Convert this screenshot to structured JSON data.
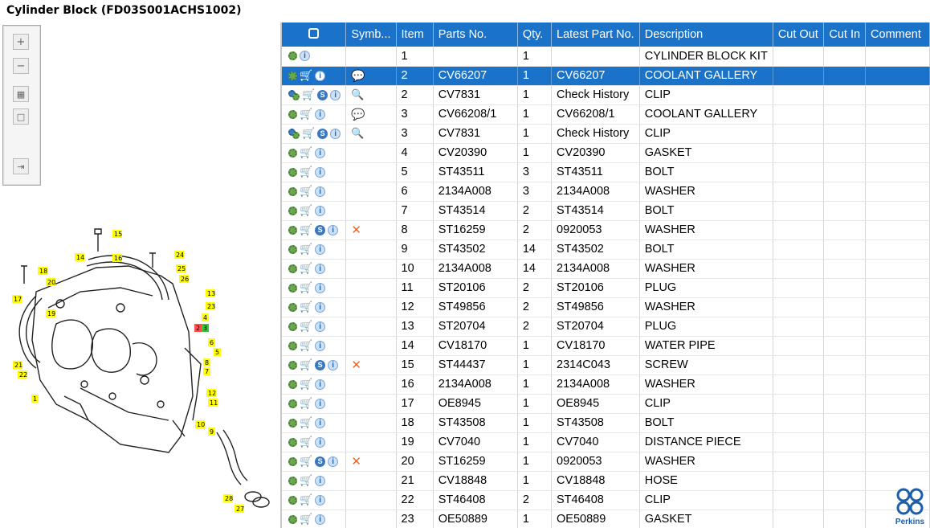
{
  "window": {
    "title": "Cylinder Block (FD03S001ACHS1002)"
  },
  "toolbar": {
    "buttons": [
      {
        "name": "zoom-in-button",
        "icon": "plus-icon"
      },
      {
        "name": "zoom-out-button",
        "icon": "minus-icon"
      },
      {
        "name": "fit-view-button",
        "icon": "grid-icon"
      },
      {
        "name": "actual-size-button",
        "icon": "square-icon"
      },
      {
        "name": "export-button",
        "icon": "export-icon"
      }
    ]
  },
  "diagram": {
    "callouts": [
      "1",
      "2",
      "3",
      "4",
      "5",
      "6",
      "7",
      "8",
      "9",
      "10",
      "11",
      "12",
      "13",
      "14",
      "15",
      "16",
      "17",
      "18",
      "19",
      "20",
      "21",
      "22",
      "23",
      "24",
      "25",
      "26",
      "27",
      "28"
    ]
  },
  "table": {
    "columns": [
      "",
      "Symb...",
      "Item",
      "Parts No.",
      "Qty.",
      "Latest Part No.",
      "Description",
      "Cut Out",
      "Cut In",
      "Comment"
    ],
    "rows": [
      {
        "icons": "gear,info",
        "sym": "",
        "item": "1",
        "part": "",
        "qty": "1",
        "latest": "",
        "desc": "CYLINDER BLOCK KIT",
        "selected": false
      },
      {
        "icons": "gear,cart,info",
        "sym": "bubble",
        "item": "2",
        "part": "CV66207",
        "qty": "1",
        "latest": "CV66207",
        "desc": "COOLANT GALLERY",
        "selected": true
      },
      {
        "icons": "gears,cart,s,info",
        "sym": "history",
        "item": "2",
        "part": "CV7831",
        "qty": "1",
        "latest": "Check History",
        "desc": "CLIP",
        "selected": false
      },
      {
        "icons": "gear,cart,info",
        "sym": "bubble",
        "item": "3",
        "part": "CV66208/1",
        "qty": "1",
        "latest": "CV66208/1",
        "desc": "COOLANT GALLERY",
        "selected": false
      },
      {
        "icons": "gears,cart,s,info",
        "sym": "history",
        "item": "3",
        "part": "CV7831",
        "qty": "1",
        "latest": "Check History",
        "desc": "CLIP",
        "selected": false
      },
      {
        "icons": "gear,cart,info",
        "sym": "",
        "item": "4",
        "part": "CV20390",
        "qty": "1",
        "latest": "CV20390",
        "desc": "GASKET",
        "selected": false
      },
      {
        "icons": "gear,cart,info",
        "sym": "",
        "item": "5",
        "part": "ST43511",
        "qty": "3",
        "latest": "ST43511",
        "desc": "BOLT",
        "selected": false
      },
      {
        "icons": "gear,cart,info",
        "sym": "",
        "item": "6",
        "part": "2134A008",
        "qty": "3",
        "latest": "2134A008",
        "desc": "WASHER",
        "selected": false
      },
      {
        "icons": "gear,cart,info",
        "sym": "",
        "item": "7",
        "part": "ST43514",
        "qty": "2",
        "latest": "ST43514",
        "desc": "BOLT",
        "selected": false
      },
      {
        "icons": "gear,cart,s,info",
        "sym": "x",
        "item": "8",
        "part": "ST16259",
        "qty": "2",
        "latest": "0920053",
        "desc": "WASHER",
        "selected": false
      },
      {
        "icons": "gear,cart,info",
        "sym": "",
        "item": "9",
        "part": "ST43502",
        "qty": "14",
        "latest": "ST43502",
        "desc": "BOLT",
        "selected": false
      },
      {
        "icons": "gear,cart,info",
        "sym": "",
        "item": "10",
        "part": "2134A008",
        "qty": "14",
        "latest": "2134A008",
        "desc": "WASHER",
        "selected": false
      },
      {
        "icons": "gear,cart,info",
        "sym": "",
        "item": "11",
        "part": "ST20106",
        "qty": "2",
        "latest": "ST20106",
        "desc": "PLUG",
        "selected": false
      },
      {
        "icons": "gear,cart,info",
        "sym": "",
        "item": "12",
        "part": "ST49856",
        "qty": "2",
        "latest": "ST49856",
        "desc": "WASHER",
        "selected": false
      },
      {
        "icons": "gear,cart,info",
        "sym": "",
        "item": "13",
        "part": "ST20704",
        "qty": "2",
        "latest": "ST20704",
        "desc": "PLUG",
        "selected": false
      },
      {
        "icons": "gear,cart,info",
        "sym": "",
        "item": "14",
        "part": "CV18170",
        "qty": "1",
        "latest": "CV18170",
        "desc": "WATER PIPE",
        "selected": false
      },
      {
        "icons": "gear,cart,s,info",
        "sym": "x",
        "item": "15",
        "part": "ST44437",
        "qty": "1",
        "latest": "2314C043",
        "desc": "SCREW",
        "selected": false
      },
      {
        "icons": "gear,cart,info",
        "sym": "",
        "item": "16",
        "part": "2134A008",
        "qty": "1",
        "latest": "2134A008",
        "desc": "WASHER",
        "selected": false
      },
      {
        "icons": "gear,cart,info",
        "sym": "",
        "item": "17",
        "part": "OE8945",
        "qty": "1",
        "latest": "OE8945",
        "desc": "CLIP",
        "selected": false
      },
      {
        "icons": "gear,cart,info",
        "sym": "",
        "item": "18",
        "part": "ST43508",
        "qty": "1",
        "latest": "ST43508",
        "desc": "BOLT",
        "selected": false
      },
      {
        "icons": "gear,cart,info",
        "sym": "",
        "item": "19",
        "part": "CV7040",
        "qty": "1",
        "latest": "CV7040",
        "desc": "DISTANCE PIECE",
        "selected": false
      },
      {
        "icons": "gear,cart,s,info",
        "sym": "x",
        "item": "20",
        "part": "ST16259",
        "qty": "1",
        "latest": "0920053",
        "desc": "WASHER",
        "selected": false
      },
      {
        "icons": "gear,cart,info",
        "sym": "",
        "item": "21",
        "part": "CV18848",
        "qty": "1",
        "latest": "CV18848",
        "desc": "HOSE",
        "selected": false
      },
      {
        "icons": "gear,cart,info",
        "sym": "",
        "item": "22",
        "part": "ST46408",
        "qty": "2",
        "latest": "ST46408",
        "desc": "CLIP",
        "selected": false
      },
      {
        "icons": "gear,cart,info",
        "sym": "",
        "item": "23",
        "part": "OE50889",
        "qty": "1",
        "latest": "OE50889",
        "desc": "GASKET",
        "selected": false
      }
    ]
  },
  "brand": {
    "name": "Perkins",
    "color": "#1a5fa8"
  },
  "colors": {
    "header": "#1a73c8",
    "selected_row": "#1a73c8",
    "callout": "#ffff00",
    "callout_active_red": "#ff5050",
    "callout_active_green": "#33cc33"
  }
}
